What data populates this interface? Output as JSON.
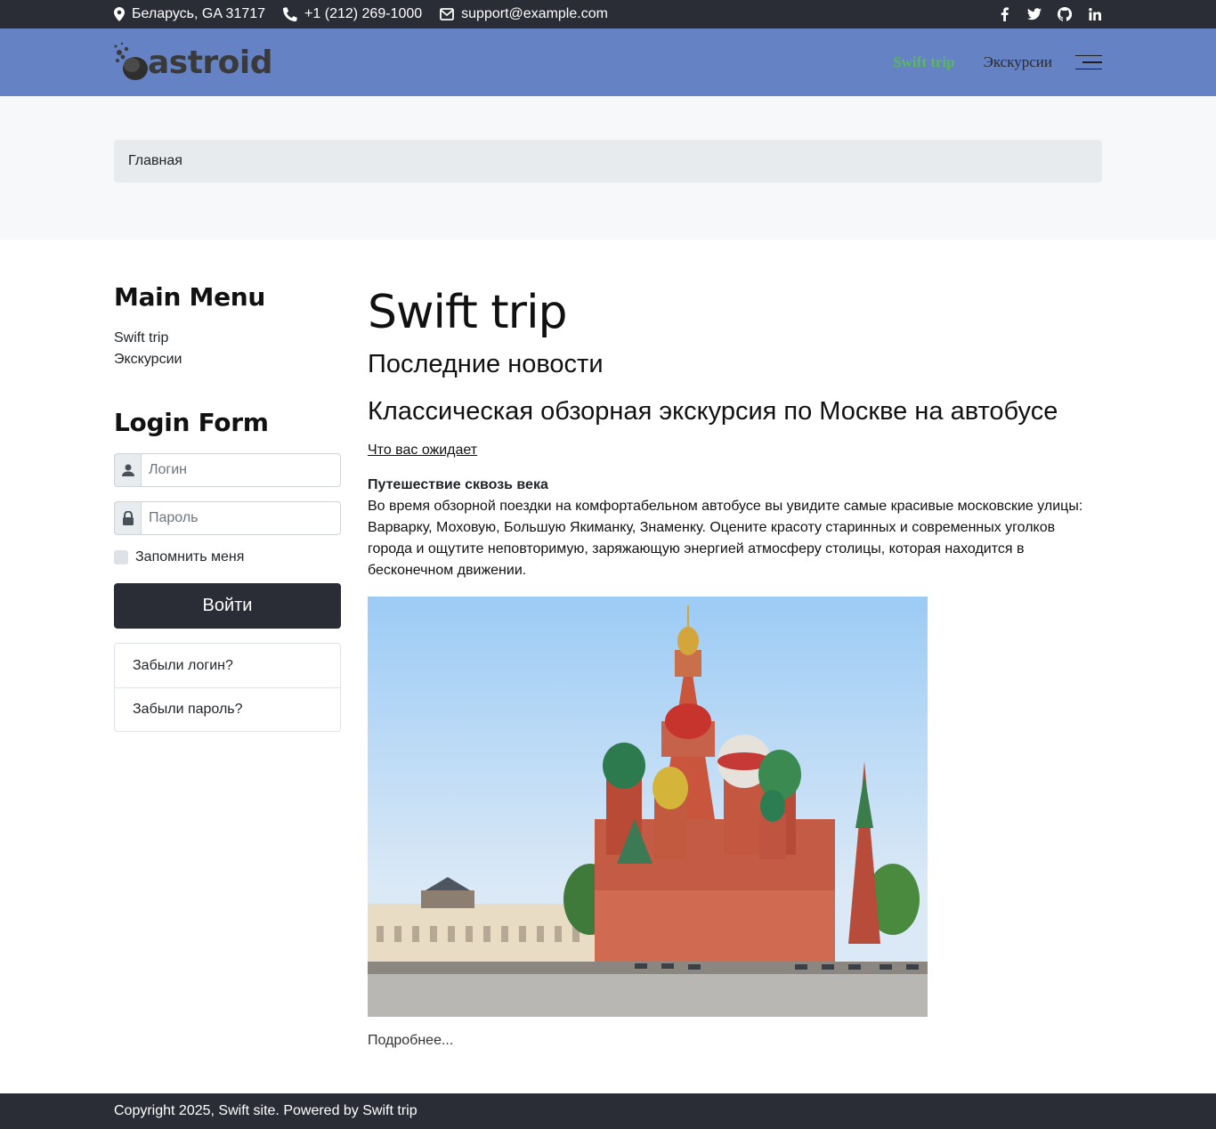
{
  "topbar": {
    "address": "Беларусь, GA 31717",
    "phone": "+1 (212) 269-1000",
    "email": "support@example.com"
  },
  "header": {
    "logo_text": "astroid",
    "nav": [
      {
        "label": "Swift trip",
        "active": true
      },
      {
        "label": "Экскурсии",
        "active": false
      }
    ]
  },
  "breadcrumb": {
    "home": "Главная"
  },
  "sidebar": {
    "menu_title": "Main Menu",
    "menu_items": [
      "Swift trip",
      "Экскурсии"
    ],
    "login_title": "Login Form",
    "login_placeholder": "Логин",
    "password_placeholder": "Пароль",
    "remember_label": "Запомнить меня",
    "submit_label": "Войти",
    "forgot_login": "Забыли логин?",
    "forgot_password": "Забыли пароль?"
  },
  "content": {
    "title": "Swift trip",
    "section_heading": "Последние новости",
    "article_title": "Классическая обзорная экскурсия по Москве на автобусе",
    "expect_link": "Что вас ожидает",
    "lead": "Путешествие сквозь века",
    "body": "Во время обзорной поездки на комфортабельном автобусе вы увидите самые красивые московские улицы: Варварку, Моховую, Большую Якиманку, Знаменку. Оцените красоту старинных и современных уголков города и ощутите неповторимую, заряжающую энергией атмосферу столицы, которая находится в бесконечном движении.",
    "read_more": "Подробнее..."
  },
  "footer": {
    "text": "Copyright 2025, Swift site. Powered by Swift trip"
  },
  "colors": {
    "topbar": "#2b2d36",
    "header": "#6482c4",
    "active_nav": "#5cb85c"
  }
}
